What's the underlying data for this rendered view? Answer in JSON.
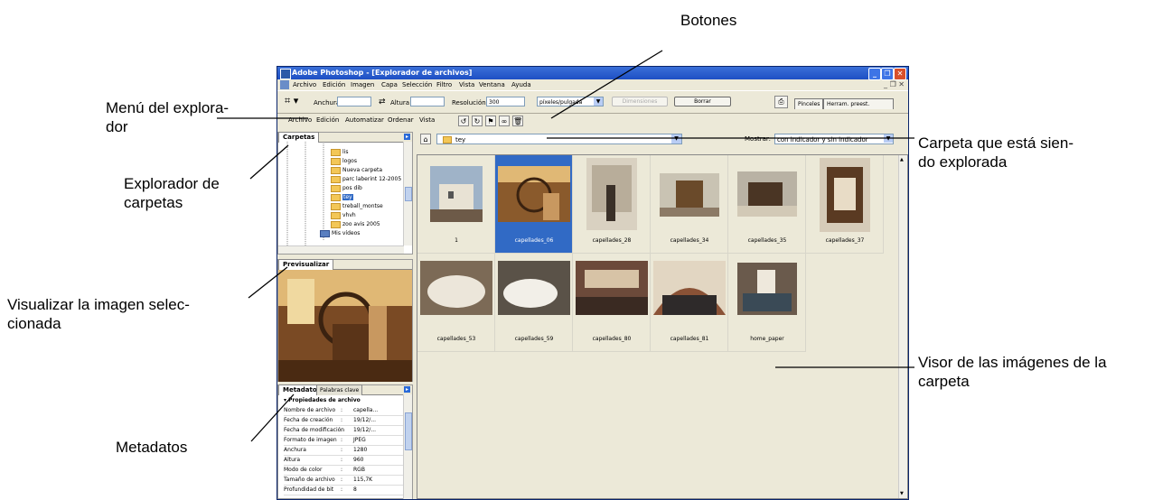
{
  "annotations": {
    "botones": "Botones",
    "menu_explorador": [
      "Menú del explora-",
      "dor"
    ],
    "explorador_carpetas": [
      "Explorador de",
      "carpetas"
    ],
    "visualizar": [
      "Visualizar la imagen selec-",
      "cionada"
    ],
    "metadatos": "Metadatos",
    "carpeta_explorada": [
      "Carpeta que está sien-",
      "do explorada"
    ],
    "visor": [
      "Visor de las imágenes de la",
      "carpeta"
    ]
  },
  "window": {
    "title": "Adobe Photoshop - [Explorador de archivos]",
    "menus": [
      "Archivo",
      "Edición",
      "Imagen",
      "Capa",
      "Selección",
      "Filtro",
      "Vista",
      "Ventana",
      "Ayuda"
    ]
  },
  "options_bar": {
    "width_label": "Anchura:",
    "height_label": "Altura:",
    "resolution_label": "Resolución:",
    "resolution_value": "300",
    "units_value": "píxeles/pulgada",
    "dimensions_button": "Dimensiones",
    "clear_button": "Borrar",
    "tab_brushes": "Pinceles",
    "tab_presets": "Herram. preest."
  },
  "browser_menu": [
    "Archivo",
    "Edición",
    "Automatizar",
    "Ordenar",
    "Vista"
  ],
  "folders_panel": {
    "tab": "Carpetas",
    "items": [
      "lis",
      "logos",
      "Nueva carpeta",
      "parc laberint 12-2005",
      "pos dib",
      "tey",
      "treball_montse",
      "vhvh",
      "zoo avis 2005"
    ],
    "selected": "tey",
    "my_videos": "Mis vídeos"
  },
  "preview_panel": {
    "tab": "Previsualizar"
  },
  "metadata_panel": {
    "tab_metadata": "Metadatos",
    "tab_keywords": "Palabras clave",
    "section": "Propiedades de archivo",
    "rows": [
      {
        "k": "Nombre de archivo",
        "v": "capella..."
      },
      {
        "k": "Fecha de creación",
        "v": "19/12/..."
      },
      {
        "k": "Fecha de modificación",
        "v": "19/12/..."
      },
      {
        "k": "Formato de imagen",
        "v": "JPEG"
      },
      {
        "k": "Anchura",
        "v": "1280"
      },
      {
        "k": "Altura",
        "v": "960"
      },
      {
        "k": "Modo de color",
        "v": "RGB"
      },
      {
        "k": "Tamaño de archivo",
        "v": "115,7K"
      },
      {
        "k": "Profundidad de bit",
        "v": "8"
      }
    ]
  },
  "path_bar": {
    "folder": "tey",
    "show_label": "Mostrar:",
    "show_value": "con indicador y sin indicador"
  },
  "thumbnails": [
    {
      "name": "1"
    },
    {
      "name": "capellades_06"
    },
    {
      "name": "capellades_28"
    },
    {
      "name": "capellades_34"
    },
    {
      "name": "capellades_35"
    },
    {
      "name": "capellades_37"
    },
    {
      "name": "capellades_53"
    },
    {
      "name": "capellades_59"
    },
    {
      "name": "capellades_80"
    },
    {
      "name": "capellades_81"
    },
    {
      "name": "home_paper"
    }
  ],
  "selected_thumbnail": "capellades_06",
  "colors": {
    "title_bar": "#1e4fc4",
    "selection": "#316ac5",
    "panel_bg": "#ece9d8"
  }
}
